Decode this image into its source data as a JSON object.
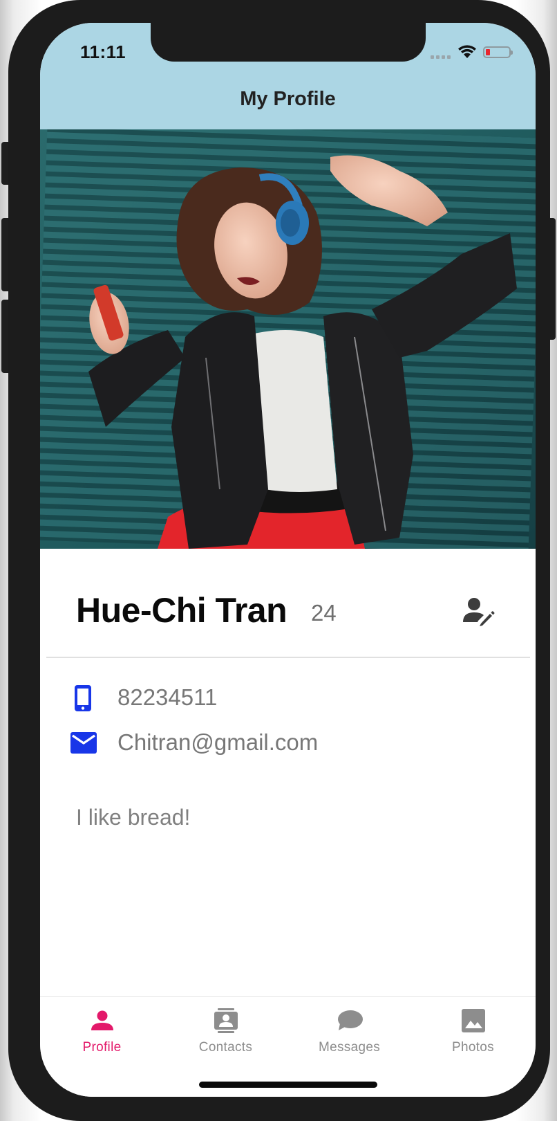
{
  "status_bar": {
    "time": "11:11",
    "battery_color": "#e8262e"
  },
  "header": {
    "title": "My Profile",
    "background": "#acd6e4"
  },
  "profile": {
    "photo_icon": "profile-photo",
    "name": "Hue-Chi Tran",
    "age": "24",
    "edit_icon": "person-edit-icon",
    "phone": "82234511",
    "email": "Chitran@gmail.com",
    "bio": "I like bread!",
    "icon_color": "#1836e8"
  },
  "tabs": [
    {
      "label": "Profile",
      "icon": "person-icon",
      "active": true
    },
    {
      "label": "Contacts",
      "icon": "contacts-icon",
      "active": false
    },
    {
      "label": "Messages",
      "icon": "chat-bubble-icon",
      "active": false
    },
    {
      "label": "Photos",
      "icon": "image-icon",
      "active": false
    }
  ],
  "colors": {
    "active_tab": "#e3196a",
    "inactive_tab": "#8d8d8d"
  }
}
